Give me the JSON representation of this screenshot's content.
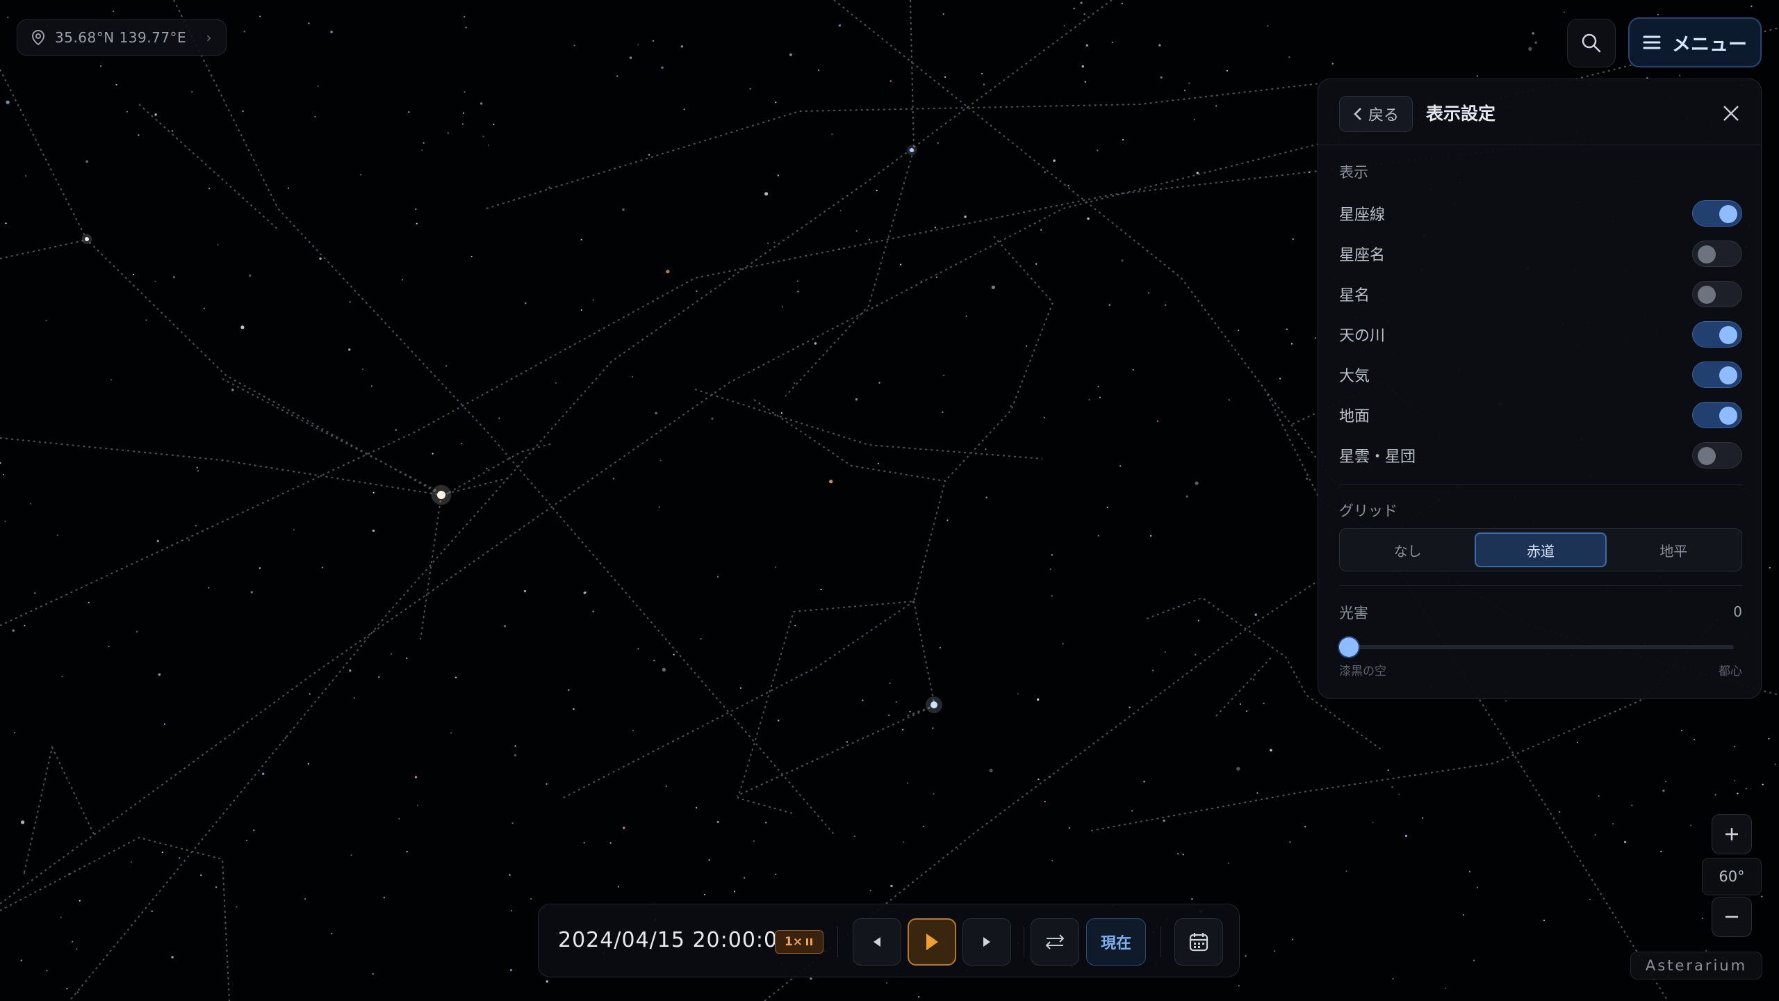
{
  "location": {
    "coords": "35.68°N 139.77°E"
  },
  "header": {
    "menu_label": "メニュー"
  },
  "panel": {
    "back_label": "戻る",
    "title": "表示設定",
    "display_section": "表示",
    "toggles": [
      {
        "label": "星座線",
        "on": true
      },
      {
        "label": "星座名",
        "on": false
      },
      {
        "label": "星名",
        "on": false
      },
      {
        "label": "天の川",
        "on": true
      },
      {
        "label": "大気",
        "on": true
      },
      {
        "label": "地面",
        "on": true
      },
      {
        "label": "星雲・星団",
        "on": false
      }
    ],
    "grid_section": "グリッド",
    "grid_options": [
      "なし",
      "赤道",
      "地平"
    ],
    "grid_selected": "赤道",
    "light_pollution": {
      "label": "光害",
      "value": "0",
      "min_label": "漆黒の空",
      "max_label": "都心"
    }
  },
  "timebar": {
    "datetime": "2024/04/15 20:00:00",
    "speed": "1×",
    "now_label": "現在"
  },
  "zoom": {
    "fov": "60°"
  },
  "brand": "Asterarium",
  "colors": {
    "accent": "#8fbcff",
    "play": "#f0a030",
    "background": "#010203"
  }
}
